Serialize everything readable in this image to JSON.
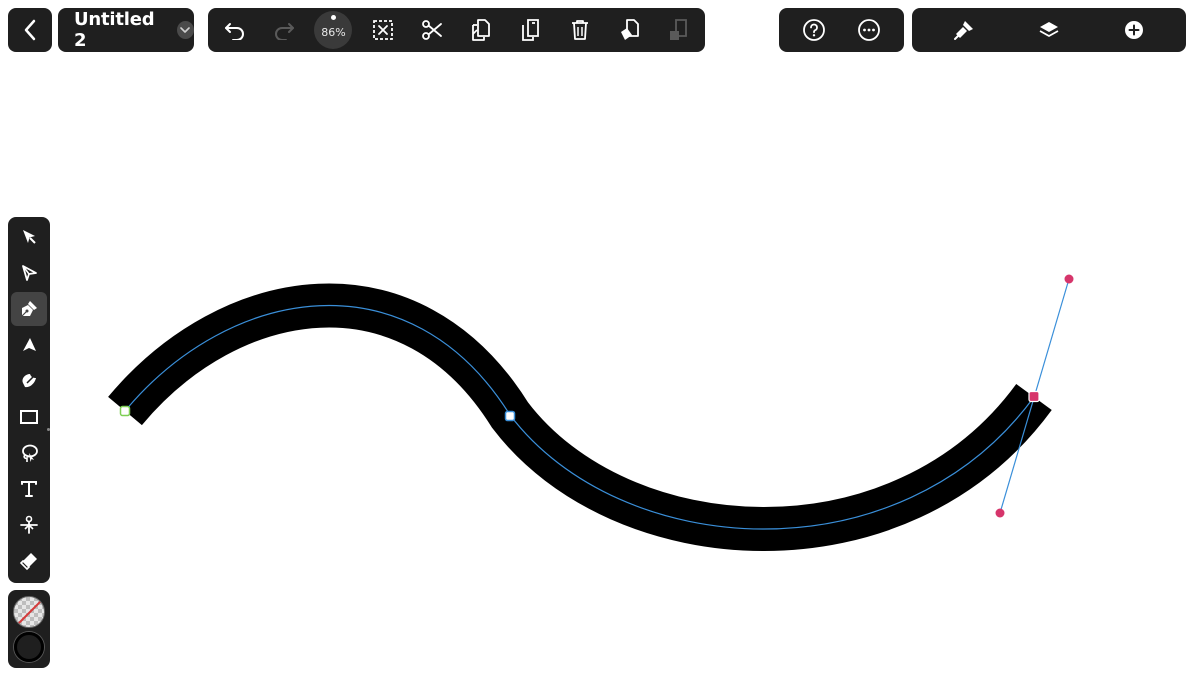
{
  "document": {
    "title": "Untitled 2",
    "zoom": "86%"
  },
  "toolbar": {
    "back_icon": "chevron-left-icon",
    "edit_icons": [
      "undo-icon",
      "redo-icon",
      "zoom-indicator",
      "deselect-icon",
      "cut-icon",
      "copy-icon",
      "paste-icon",
      "delete-icon",
      "duplicate-icon",
      "paste-in-place-icon"
    ],
    "help_icons": [
      "help-icon",
      "more-icon"
    ],
    "panel_icons": [
      "style-brush-icon",
      "layers-icon",
      "add-icon"
    ]
  },
  "tools": [
    {
      "name": "selection-tool",
      "icon": "arrow-icon",
      "active": false
    },
    {
      "name": "direct-selection-tool",
      "icon": "direct-arrow-icon",
      "active": false
    },
    {
      "name": "pen-tool",
      "icon": "pen-nib-icon",
      "active": true
    },
    {
      "name": "node-tool",
      "icon": "node-icon",
      "active": false
    },
    {
      "name": "brush-tool",
      "icon": "brush-icon",
      "active": false
    },
    {
      "name": "rectangle-tool",
      "icon": "rectangle-icon",
      "active": false
    },
    {
      "name": "lasso-tool",
      "icon": "lasso-icon",
      "active": false
    },
    {
      "name": "text-tool",
      "icon": "text-icon",
      "active": false
    },
    {
      "name": "scissors-tool",
      "icon": "scissors-icon",
      "active": false
    },
    {
      "name": "eraser-tool",
      "icon": "eraser-icon",
      "active": false
    }
  ],
  "colors": {
    "fill": "none",
    "stroke": "#000000",
    "path_guide": "#3a8fd9",
    "anchor_selected": "#d6356b",
    "anchor_start": "#7fcf55",
    "toolbar_bg": "#1f1f1f"
  }
}
